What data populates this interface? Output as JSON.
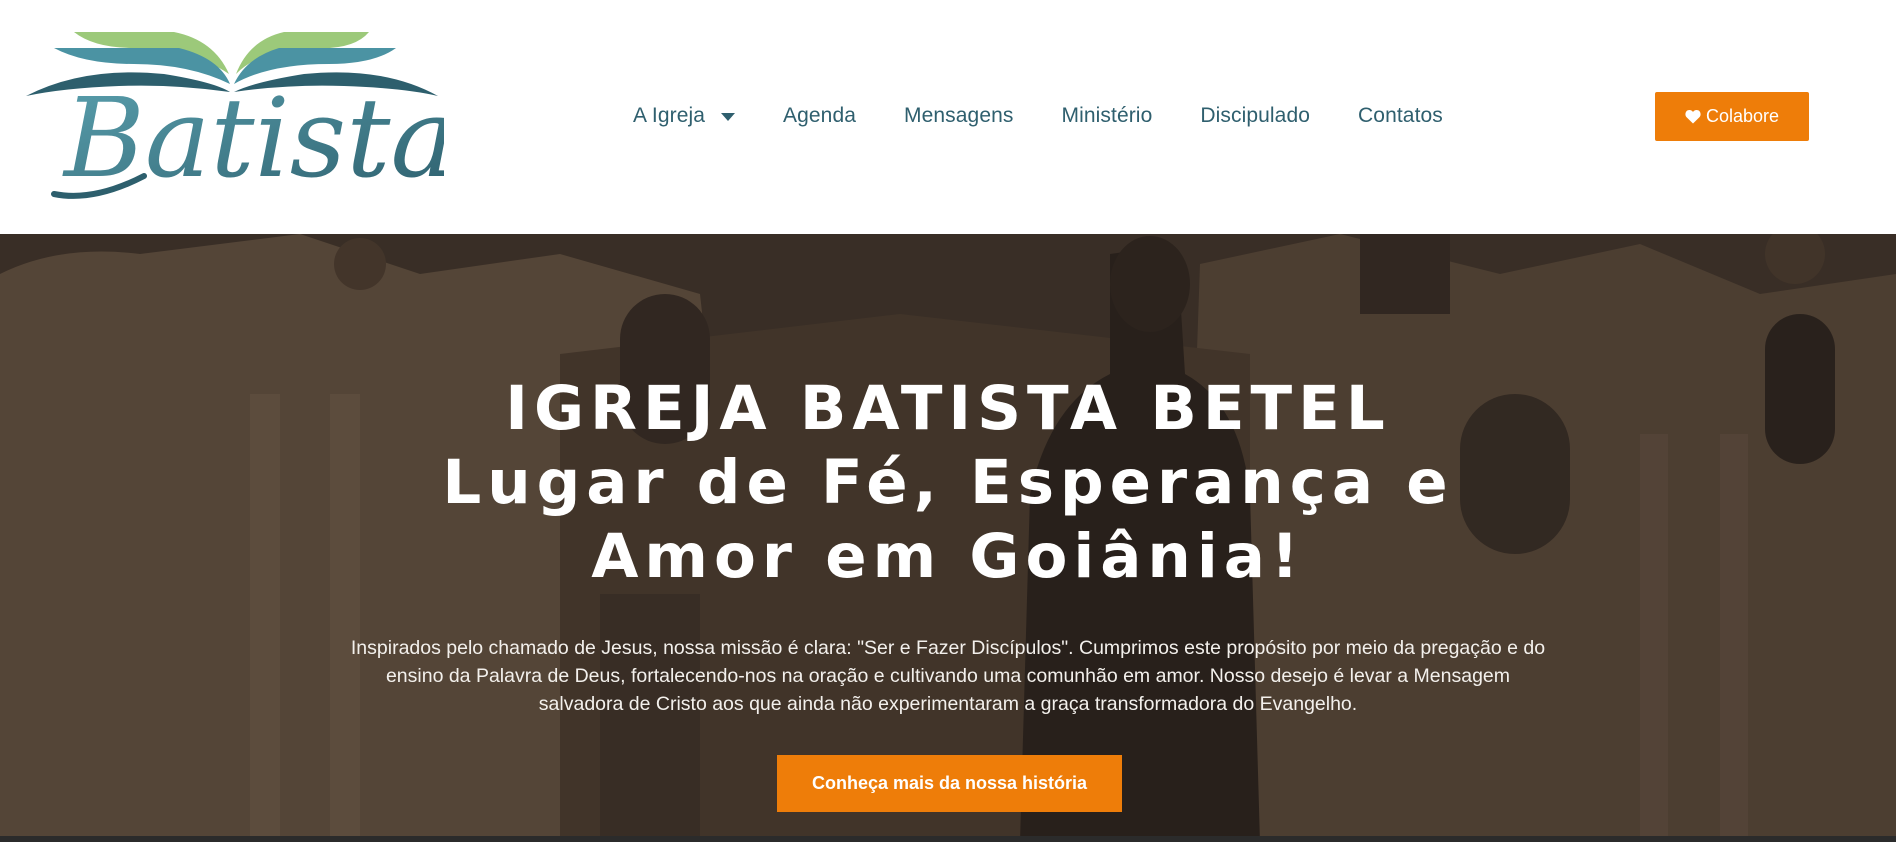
{
  "header": {
    "logo_text": "Batista",
    "nav": [
      {
        "label": "A Igreja",
        "has_dropdown": true
      },
      {
        "label": "Agenda"
      },
      {
        "label": "Mensagens"
      },
      {
        "label": "Ministério"
      },
      {
        "label": "Discipulado"
      },
      {
        "label": "Contatos"
      }
    ],
    "donate_label": "Colabore",
    "donate_icon": "heart-icon"
  },
  "hero": {
    "title": "IGREJA BATISTA BETEL",
    "subtitle": "Lugar de Fé, Esperança e Amor em Goiânia!",
    "text": "Inspirados pelo chamado de Jesus, nossa missão é clara: \"Ser e Fazer Discípulos\". Cumprimos este propósito por meio da pregação e do ensino da Palavra de Deus, fortalecendo-nos na oração e cultivando uma comunhão em amor. Nosso desejo é levar a Mensagem salvadora de Cristo aos que ainda não experimentaram a graça transformadora do Evangelho.",
    "cta_label": "Conheça mais da nossa história"
  },
  "colors": {
    "accent": "#ee7d09",
    "nav_text": "#2f5f6e",
    "logo_green": "#9cc97a",
    "logo_blue": "#4b93a3",
    "logo_dark": "#2d5f6d"
  }
}
